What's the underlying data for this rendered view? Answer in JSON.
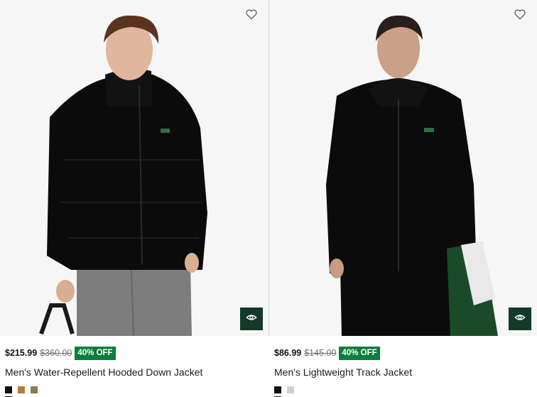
{
  "products": [
    {
      "price": "$215.99",
      "original_price": "$360.00",
      "discount_badge": "40% OFF",
      "title": "Men's Water-Repellent Hooded Down Jacket",
      "swatches": [
        "#111111",
        "#b67a47",
        "#8a7c57"
      ],
      "icons": {
        "wishlist": "heart-outline-icon",
        "quick_view": "eye-icon"
      }
    },
    {
      "price": "$86.99",
      "original_price": "$145.00",
      "discount_badge": "40% OFF",
      "title": "Men's Lightweight Track Jacket",
      "swatches": [
        "#111111",
        "#cfcfcf"
      ],
      "icons": {
        "wishlist": "heart-outline-icon",
        "quick_view": "eye-icon"
      }
    }
  ],
  "colors": {
    "accent": "#13392b",
    "badge": "#0a7f3b",
    "image_bg": "#f6f6f6"
  }
}
